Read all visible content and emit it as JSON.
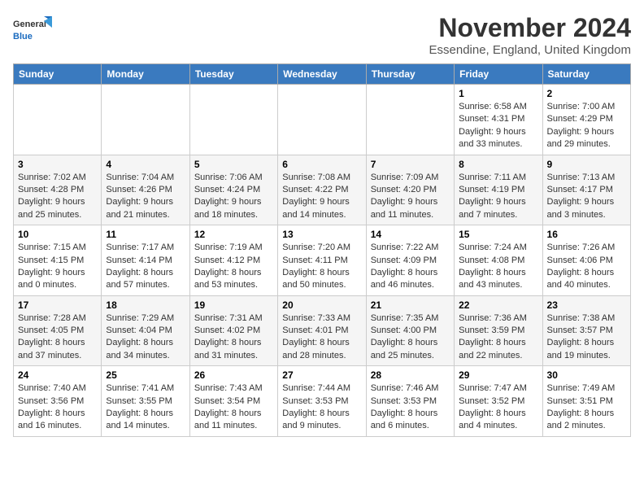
{
  "logo": {
    "text_general": "General",
    "text_blue": "Blue"
  },
  "header": {
    "month": "November 2024",
    "location": "Essendine, England, United Kingdom"
  },
  "weekdays": [
    "Sunday",
    "Monday",
    "Tuesday",
    "Wednesday",
    "Thursday",
    "Friday",
    "Saturday"
  ],
  "weeks": [
    [
      {
        "day": "",
        "info": ""
      },
      {
        "day": "",
        "info": ""
      },
      {
        "day": "",
        "info": ""
      },
      {
        "day": "",
        "info": ""
      },
      {
        "day": "",
        "info": ""
      },
      {
        "day": "1",
        "info": "Sunrise: 6:58 AM\nSunset: 4:31 PM\nDaylight: 9 hours and 33 minutes."
      },
      {
        "day": "2",
        "info": "Sunrise: 7:00 AM\nSunset: 4:29 PM\nDaylight: 9 hours and 29 minutes."
      }
    ],
    [
      {
        "day": "3",
        "info": "Sunrise: 7:02 AM\nSunset: 4:28 PM\nDaylight: 9 hours and 25 minutes."
      },
      {
        "day": "4",
        "info": "Sunrise: 7:04 AM\nSunset: 4:26 PM\nDaylight: 9 hours and 21 minutes."
      },
      {
        "day": "5",
        "info": "Sunrise: 7:06 AM\nSunset: 4:24 PM\nDaylight: 9 hours and 18 minutes."
      },
      {
        "day": "6",
        "info": "Sunrise: 7:08 AM\nSunset: 4:22 PM\nDaylight: 9 hours and 14 minutes."
      },
      {
        "day": "7",
        "info": "Sunrise: 7:09 AM\nSunset: 4:20 PM\nDaylight: 9 hours and 11 minutes."
      },
      {
        "day": "8",
        "info": "Sunrise: 7:11 AM\nSunset: 4:19 PM\nDaylight: 9 hours and 7 minutes."
      },
      {
        "day": "9",
        "info": "Sunrise: 7:13 AM\nSunset: 4:17 PM\nDaylight: 9 hours and 3 minutes."
      }
    ],
    [
      {
        "day": "10",
        "info": "Sunrise: 7:15 AM\nSunset: 4:15 PM\nDaylight: 9 hours and 0 minutes."
      },
      {
        "day": "11",
        "info": "Sunrise: 7:17 AM\nSunset: 4:14 PM\nDaylight: 8 hours and 57 minutes."
      },
      {
        "day": "12",
        "info": "Sunrise: 7:19 AM\nSunset: 4:12 PM\nDaylight: 8 hours and 53 minutes."
      },
      {
        "day": "13",
        "info": "Sunrise: 7:20 AM\nSunset: 4:11 PM\nDaylight: 8 hours and 50 minutes."
      },
      {
        "day": "14",
        "info": "Sunrise: 7:22 AM\nSunset: 4:09 PM\nDaylight: 8 hours and 46 minutes."
      },
      {
        "day": "15",
        "info": "Sunrise: 7:24 AM\nSunset: 4:08 PM\nDaylight: 8 hours and 43 minutes."
      },
      {
        "day": "16",
        "info": "Sunrise: 7:26 AM\nSunset: 4:06 PM\nDaylight: 8 hours and 40 minutes."
      }
    ],
    [
      {
        "day": "17",
        "info": "Sunrise: 7:28 AM\nSunset: 4:05 PM\nDaylight: 8 hours and 37 minutes."
      },
      {
        "day": "18",
        "info": "Sunrise: 7:29 AM\nSunset: 4:04 PM\nDaylight: 8 hours and 34 minutes."
      },
      {
        "day": "19",
        "info": "Sunrise: 7:31 AM\nSunset: 4:02 PM\nDaylight: 8 hours and 31 minutes."
      },
      {
        "day": "20",
        "info": "Sunrise: 7:33 AM\nSunset: 4:01 PM\nDaylight: 8 hours and 28 minutes."
      },
      {
        "day": "21",
        "info": "Sunrise: 7:35 AM\nSunset: 4:00 PM\nDaylight: 8 hours and 25 minutes."
      },
      {
        "day": "22",
        "info": "Sunrise: 7:36 AM\nSunset: 3:59 PM\nDaylight: 8 hours and 22 minutes."
      },
      {
        "day": "23",
        "info": "Sunrise: 7:38 AM\nSunset: 3:57 PM\nDaylight: 8 hours and 19 minutes."
      }
    ],
    [
      {
        "day": "24",
        "info": "Sunrise: 7:40 AM\nSunset: 3:56 PM\nDaylight: 8 hours and 16 minutes."
      },
      {
        "day": "25",
        "info": "Sunrise: 7:41 AM\nSunset: 3:55 PM\nDaylight: 8 hours and 14 minutes."
      },
      {
        "day": "26",
        "info": "Sunrise: 7:43 AM\nSunset: 3:54 PM\nDaylight: 8 hours and 11 minutes."
      },
      {
        "day": "27",
        "info": "Sunrise: 7:44 AM\nSunset: 3:53 PM\nDaylight: 8 hours and 9 minutes."
      },
      {
        "day": "28",
        "info": "Sunrise: 7:46 AM\nSunset: 3:53 PM\nDaylight: 8 hours and 6 minutes."
      },
      {
        "day": "29",
        "info": "Sunrise: 7:47 AM\nSunset: 3:52 PM\nDaylight: 8 hours and 4 minutes."
      },
      {
        "day": "30",
        "info": "Sunrise: 7:49 AM\nSunset: 3:51 PM\nDaylight: 8 hours and 2 minutes."
      }
    ]
  ]
}
